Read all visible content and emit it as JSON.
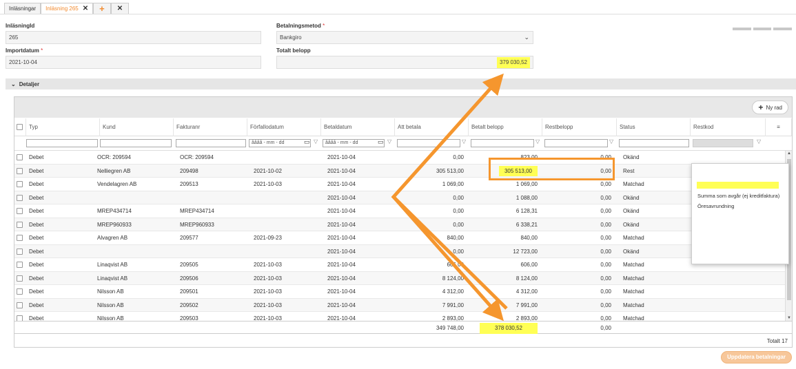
{
  "tabs": [
    {
      "label": "Inläsningar",
      "active": false
    },
    {
      "label": "Inläsning 265",
      "active": true
    }
  ],
  "form": {
    "inlasningid_label": "InläsningId",
    "inlasningid_value": "265",
    "betalningsmetod_label": "Betalningsmetod",
    "betalningsmetod_value": "Bankgiro",
    "importdatum_label": "Importdatum",
    "importdatum_value": "2021-10-04",
    "totalt_belopp_label": "Totalt belopp",
    "totalt_belopp_value": "379 030,52",
    "required_mark": "*"
  },
  "section": {
    "label": "Detaljer"
  },
  "toolbar": {
    "new_row_label": "Ny rad"
  },
  "columns": [
    "Typ",
    "Kund",
    "Fakturanr",
    "Förfallodatum",
    "Betaldatum",
    "Att betala",
    "Betalt belopp",
    "Restbelopp",
    "Status",
    "Restkod"
  ],
  "filters": {
    "date_placeholder": "åååå - mm - dd"
  },
  "rows": [
    {
      "typ": "Debet",
      "kund": "OCR: 209594",
      "faktura": "OCR: 209594",
      "forfallo": "",
      "betal": "2021-10-04",
      "att": "0,00",
      "betalt": "823,00",
      "rest": "0,00",
      "status": "Okänd"
    },
    {
      "typ": "Debet",
      "kund": "Nelliegren AB",
      "faktura": "209498",
      "forfallo": "2021-10-02",
      "betal": "2021-10-04",
      "att": "305 513,00",
      "betalt": "305 513,00",
      "rest": "0,00",
      "status": "Rest"
    },
    {
      "typ": "Debet",
      "kund": "Vendelagren AB",
      "faktura": "209513",
      "forfallo": "2021-10-03",
      "betal": "2021-10-04",
      "att": "1 069,00",
      "betalt": "1 069,00",
      "rest": "0,00",
      "status": "Matchad"
    },
    {
      "typ": "Debet",
      "kund": "",
      "faktura": "",
      "forfallo": "",
      "betal": "2021-10-04",
      "att": "0,00",
      "betalt": "1 088,00",
      "rest": "0,00",
      "status": "Okänd"
    },
    {
      "typ": "Debet",
      "kund": "MREP434714",
      "faktura": "MREP434714",
      "forfallo": "",
      "betal": "2021-10-04",
      "att": "0,00",
      "betalt": "6 128,31",
      "rest": "0,00",
      "status": "Okänd"
    },
    {
      "typ": "Debet",
      "kund": "MREP960933",
      "faktura": "MREP960933",
      "forfallo": "",
      "betal": "2021-10-04",
      "att": "0,00",
      "betalt": "6 338,21",
      "rest": "0,00",
      "status": "Okänd"
    },
    {
      "typ": "Debet",
      "kund": "Alvagren AB",
      "faktura": "209577",
      "forfallo": "2021-09-23",
      "betal": "2021-10-04",
      "att": "840,00",
      "betalt": "840,00",
      "rest": "0,00",
      "status": "Matchad"
    },
    {
      "typ": "Debet",
      "kund": "",
      "faktura": "",
      "forfallo": "",
      "betal": "2021-10-04",
      "att": "0,00",
      "betalt": "12 723,00",
      "rest": "0,00",
      "status": "Okänd"
    },
    {
      "typ": "Debet",
      "kund": "Linaqvist AB",
      "faktura": "209505",
      "forfallo": "2021-10-03",
      "betal": "2021-10-04",
      "att": "606,00",
      "betalt": "606,00",
      "rest": "0,00",
      "status": "Matchad"
    },
    {
      "typ": "Debet",
      "kund": "Linaqvist AB",
      "faktura": "209506",
      "forfallo": "2021-10-03",
      "betal": "2021-10-04",
      "att": "8 124,00",
      "betalt": "8 124,00",
      "rest": "0,00",
      "status": "Matchad"
    },
    {
      "typ": "Debet",
      "kund": "Nilsson AB",
      "faktura": "209501",
      "forfallo": "2021-10-03",
      "betal": "2021-10-04",
      "att": "4 312,00",
      "betalt": "4 312,00",
      "rest": "0,00",
      "status": "Matchad"
    },
    {
      "typ": "Debet",
      "kund": "Nilsson AB",
      "faktura": "209502",
      "forfallo": "2021-10-03",
      "betal": "2021-10-04",
      "att": "7 991,00",
      "betalt": "7 991,00",
      "rest": "0,00",
      "status": "Matchad"
    },
    {
      "typ": "Debet",
      "kund": "Nilsson AB",
      "faktura": "209503",
      "forfallo": "2021-10-03",
      "betal": "2021-10-04",
      "att": "2 893,00",
      "betalt": "2 893,00",
      "rest": "0,00",
      "status": "Matchad"
    }
  ],
  "totals": {
    "att_betala": "349 748,00",
    "betalt": "378 030,52",
    "rest": "0,00"
  },
  "footer": {
    "total_label": "Totalt 17"
  },
  "popup": {
    "items": [
      "Summa som avgår (ej kreditfaktura)",
      "Öresavrundning"
    ]
  },
  "actions": {
    "update_label": "Uppdatera betalningar"
  },
  "colors": {
    "accent": "#f28b30",
    "highlight": "#ffff55",
    "arrow": "#f5962e"
  }
}
